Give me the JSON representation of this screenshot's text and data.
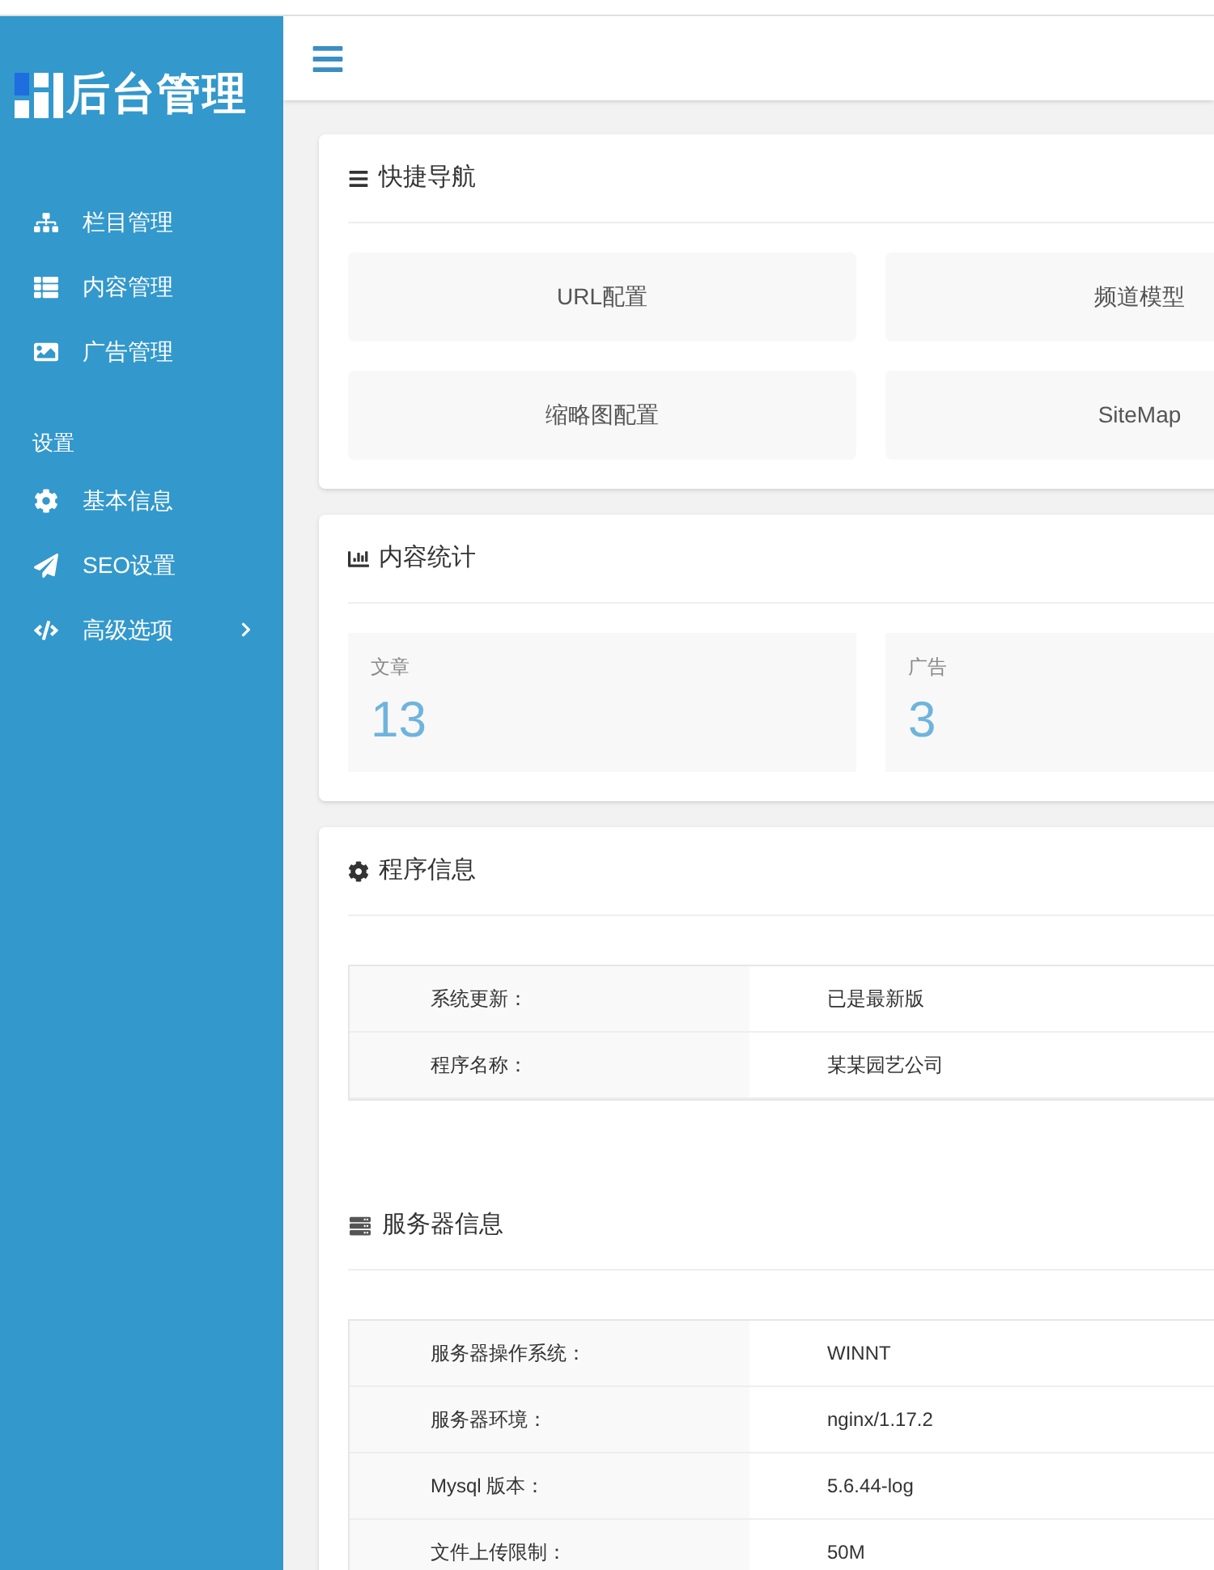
{
  "sidebar": {
    "logo": "后台管理",
    "groups": [
      {
        "items": [
          {
            "label": "栏目管理",
            "has_submenu": false
          },
          {
            "label": "内容管理",
            "has_submenu": false
          },
          {
            "label": "广告管理",
            "has_submenu": false
          }
        ]
      },
      {
        "heading": "设置",
        "items": [
          {
            "label": "基本信息",
            "has_submenu": false
          },
          {
            "label": "SEO设置",
            "has_submenu": false
          },
          {
            "label": "高级选项",
            "has_submenu": true
          }
        ]
      }
    ]
  },
  "quick_nav": {
    "title": "快捷导航",
    "links": [
      "URL配置",
      "频道模型",
      "缩略图配置",
      "SiteMap"
    ]
  },
  "content_stats": {
    "title": "内容统计",
    "stats": [
      {
        "label": "文章",
        "value": "13"
      },
      {
        "label": "广告",
        "value": "3"
      }
    ]
  },
  "program_info": {
    "title": "程序信息",
    "rows": [
      {
        "label": "系统更新：",
        "value": "已是最新版"
      },
      {
        "label": "程序名称：",
        "value": "某某园艺公司"
      }
    ]
  },
  "server_info": {
    "title": "服务器信息",
    "rows": [
      {
        "label": "服务器操作系统：",
        "value": "WINNT"
      },
      {
        "label": "服务器环境：",
        "value": "nginx/1.17.2"
      },
      {
        "label": "Mysql 版本：",
        "value": "5.6.44-log"
      },
      {
        "label": "文件上传限制：",
        "value": "50M"
      }
    ]
  }
}
